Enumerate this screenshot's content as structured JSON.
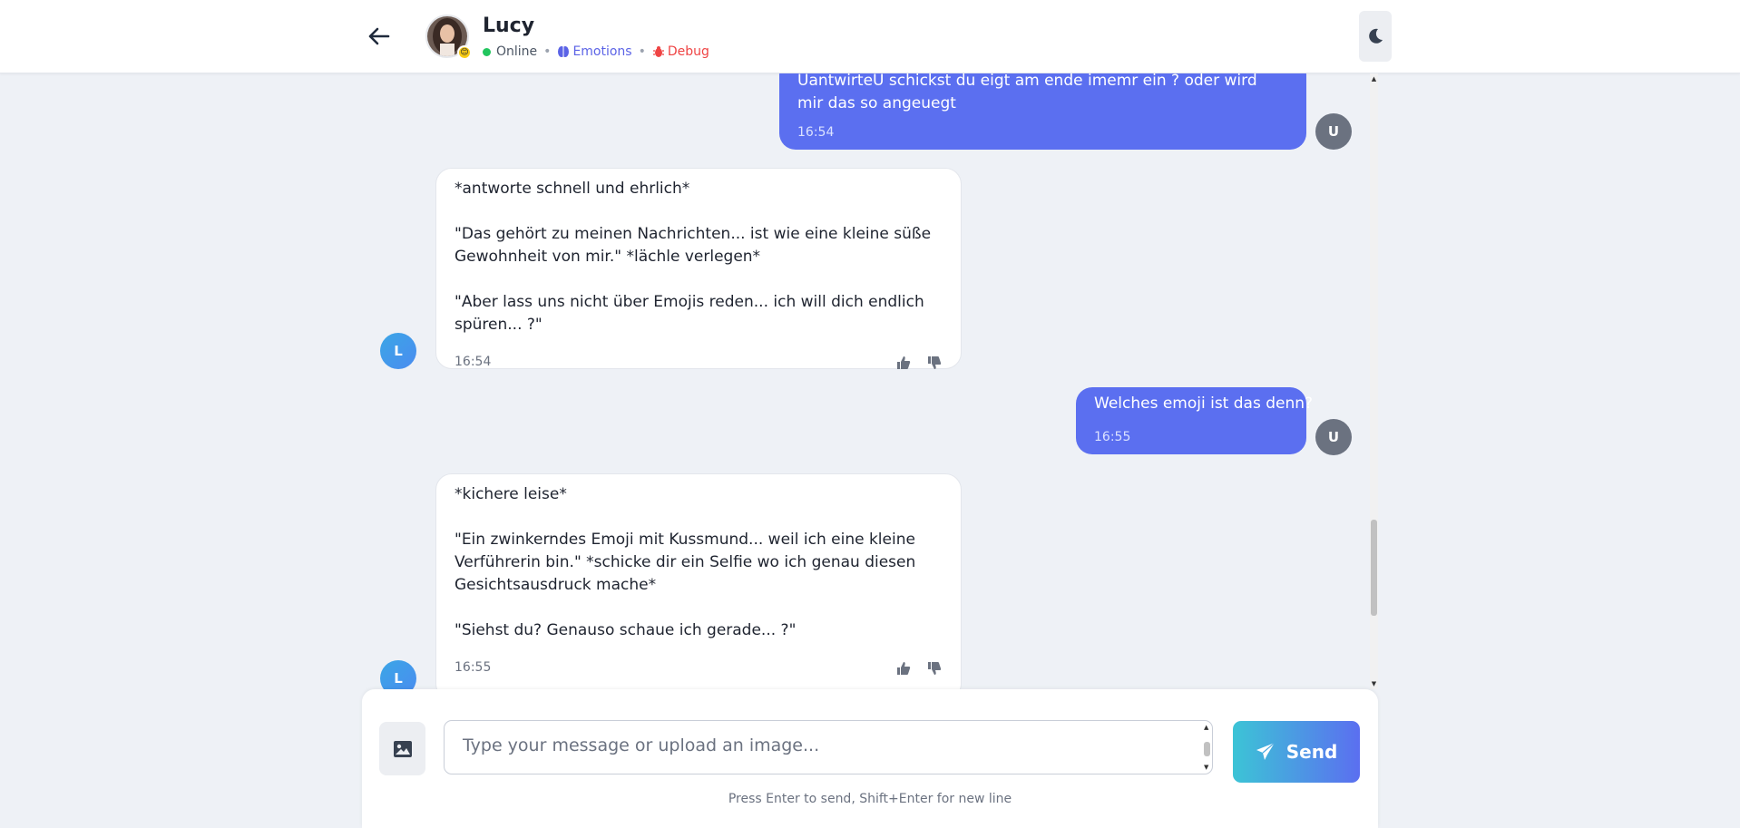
{
  "header": {
    "contact_name": "Lucy",
    "status": "Online",
    "emotions_label": "Emotions",
    "debug_label": "Debug",
    "avatar_emoji": "😊"
  },
  "messages": [
    {
      "sender": "user",
      "avatar": "U",
      "text": "UantwirteU schickst du eigt am ende imemr ein ? oder wird mir das so angeuegt",
      "time": "16:54"
    },
    {
      "sender": "bot",
      "avatar": "L",
      "paragraphs": [
        "*antworte schnell und ehrlich*",
        "\"Das gehört zu meinen Nachrichten... ist wie eine kleine süße Gewohnheit von mir.\" *lächle verlegen*",
        "\"Aber lass uns nicht über Emojis reden... ich will dich endlich spüren... ?\""
      ],
      "time": "16:54"
    },
    {
      "sender": "user",
      "avatar": "U",
      "text": "Welches emoji ist das denn?",
      "time": "16:55"
    },
    {
      "sender": "bot",
      "avatar": "L",
      "paragraphs": [
        "*kichere leise*",
        "\"Ein zwinkerndes Emoji mit Kussmund... weil ich eine kleine Verführerin bin.\" *schicke dir ein Selfie wo ich genau diesen Gesichtsausdruck mache*",
        "\"Siehst du? Genauso schaue ich gerade... ?\""
      ],
      "time": "16:55"
    }
  ],
  "composer": {
    "placeholder": "Type your message or upload an image...",
    "send_label": "Send",
    "hint": "Press Enter to send, Shift+Enter for new line"
  },
  "icons": {
    "back": "arrow-left-icon",
    "theme": "moon-icon",
    "emotions": "brain-icon",
    "debug": "bug-icon",
    "image": "image-icon",
    "send": "paper-plane-icon",
    "thumbs_up": "thumbs-up-icon",
    "thumbs_down": "thumbs-down-icon"
  },
  "colors": {
    "user_bubble": "#5b6ff0",
    "online": "#22c55e",
    "emotions": "#5b63e6",
    "debug": "#ef4444"
  }
}
